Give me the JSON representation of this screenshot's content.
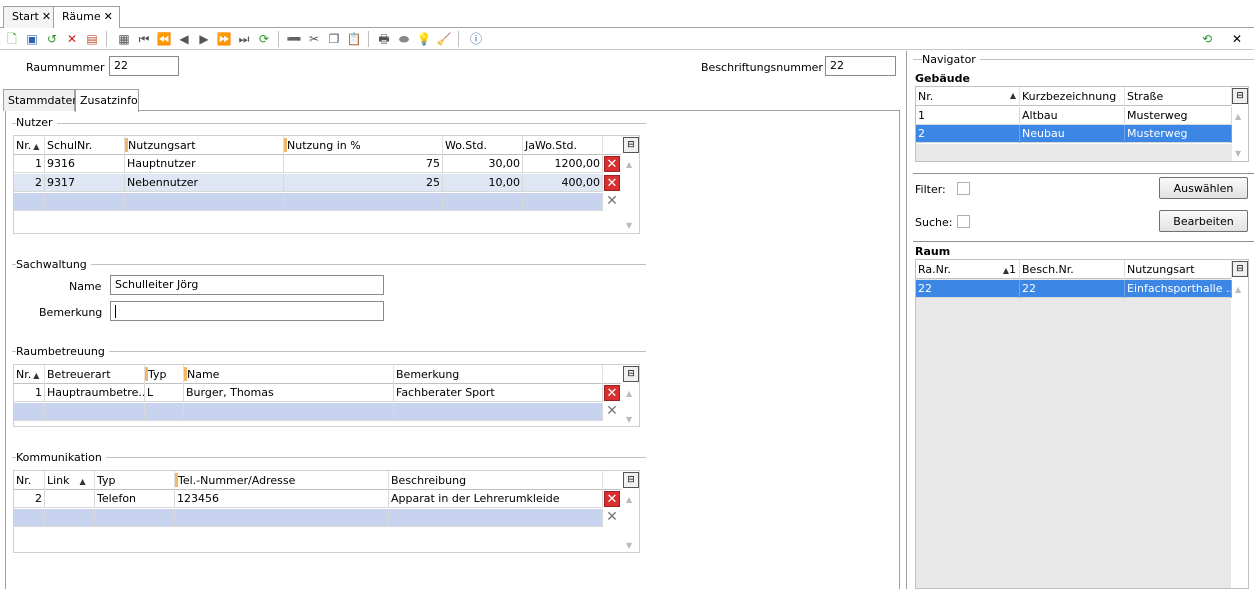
{
  "tabs": [
    {
      "label": "Start"
    },
    {
      "label": "Räume"
    }
  ],
  "header": {
    "raumnummer_label": "Raumnummer",
    "raumnummer_value": "22",
    "beschriftung_label": "Beschriftungsnummer",
    "beschriftung_value": "22"
  },
  "subtabs": [
    {
      "label": "Stammdaten"
    },
    {
      "label": "Zusatzinfo"
    }
  ],
  "nutzer": {
    "title": "Nutzer",
    "columns": [
      "Nr.",
      "SchulNr.",
      "Nutzungsart",
      "Nutzung in %",
      "Wo.Std.",
      "JaWo.Std."
    ],
    "rows": [
      [
        "1",
        "9316",
        "Hauptnutzer",
        "75",
        "30,00",
        "1200,00"
      ],
      [
        "2",
        "9317",
        "Nebennutzer",
        "25",
        "10,00",
        "400,00"
      ]
    ]
  },
  "sachwaltung": {
    "title": "Sachwaltung",
    "name_label": "Name",
    "name_value": "Schulleiter Jörg",
    "bemerkung_label": "Bemerkung",
    "bemerkung_value": ""
  },
  "raumbetreuung": {
    "title": "Raumbetreuung",
    "columns": [
      "Nr.",
      "Betreuerart",
      "Typ",
      "Name",
      "Bemerkung"
    ],
    "rows": [
      [
        "1",
        "Hauptraumbetre...",
        "L",
        "Burger, Thomas",
        "Fachberater Sport"
      ]
    ]
  },
  "kommunikation": {
    "title": "Kommunikation",
    "columns": [
      "Nr.",
      "Link",
      "Typ",
      "Tel.-Nummer/Adresse",
      "Beschreibung"
    ],
    "rows": [
      [
        "2",
        "",
        "Telefon",
        "123456",
        "Apparat in der Lehrerumkleide"
      ]
    ]
  },
  "navigator": {
    "title": "Navigator",
    "gebaeude_title": "Gebäude",
    "gebaeude_columns": [
      "Nr.",
      "Kurzbezeichnung",
      "Straße"
    ],
    "gebaeude_rows": [
      [
        "1",
        "Altbau",
        "Musterweg"
      ],
      [
        "2",
        "Neubau",
        "Musterweg"
      ]
    ],
    "filter_label": "Filter:",
    "suche_label": "Suche:",
    "auswaehlen_label": "Auswählen",
    "bearbeiten_label": "Bearbeiten",
    "raum_title": "Raum",
    "raum_columns": [
      "Ra.Nr.",
      "Besch.Nr.",
      "Nutzungsart"
    ],
    "raum_sort_index": "1",
    "raum_rows": [
      [
        "22",
        "22",
        "Einfachsporthalle ..."
      ]
    ]
  }
}
